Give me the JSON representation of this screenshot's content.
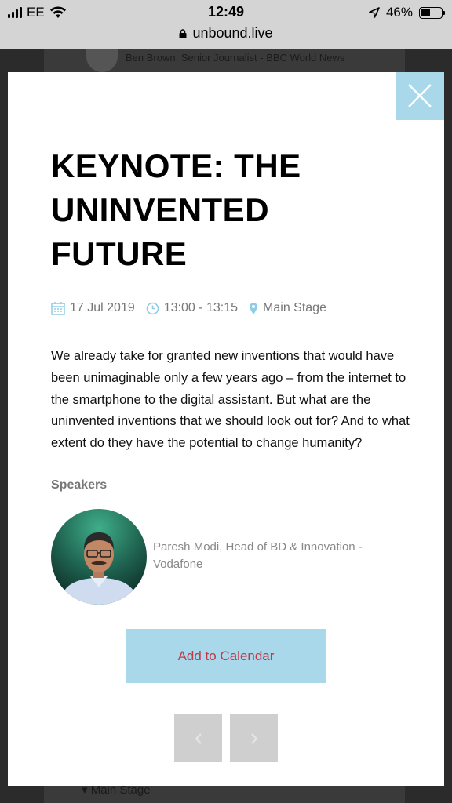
{
  "status_bar": {
    "carrier": "EE",
    "time": "12:49",
    "battery_text": "46%",
    "battery_level": 0.46,
    "url": "unbound.live"
  },
  "background": {
    "speaker_text": "Ben Brown, Senior Journalist - BBC World News",
    "stage_text": "Main Stage"
  },
  "modal": {
    "title": "KEYNOTE: THE UNINVENTED FUTURE",
    "meta": {
      "date": "17 Jul 2019",
      "time": "13:00 - 13:15",
      "location": "Main Stage"
    },
    "description": "We already take for granted new inventions that would have been unimaginable only a few years ago – from the internet to the smartphone to the digital assistant. But what are the uninvented inventions that we should look out for? And to what extent do they have the potential to change humanity?",
    "speakers_heading": "Speakers",
    "speaker": {
      "name": "Paresh Modi, Head of BD & Innovation - Vodafone"
    },
    "add_to_calendar": "Add to Calendar"
  },
  "colors": {
    "accent": "#a8d8ea",
    "button_text": "#c0394b",
    "meta_icon": "#8ecde6"
  },
  "icons": [
    "signal-icon",
    "wifi-icon",
    "location-arrow-icon",
    "battery-icon",
    "lock-icon",
    "close-icon",
    "calendar-icon",
    "clock-icon",
    "map-pin-icon",
    "chevron-left-icon",
    "chevron-right-icon"
  ]
}
